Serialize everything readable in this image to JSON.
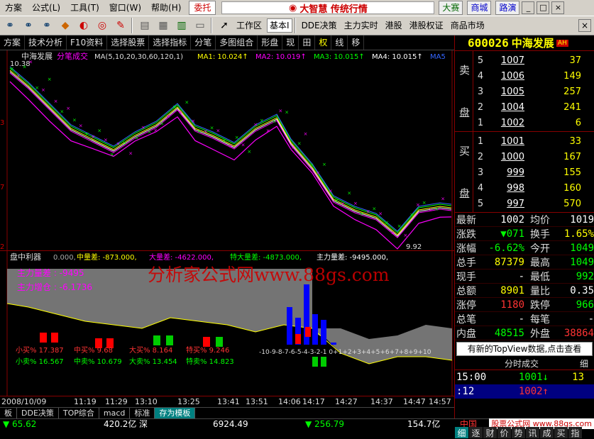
{
  "menu": {
    "items": [
      "方案",
      "公式(L)",
      "工具(T)",
      "窗口(W)",
      "帮助(H)"
    ],
    "trust": "委托",
    "brand": "大智慧 传统行情",
    "right_buttons": [
      "大赛",
      "商城",
      "路演"
    ],
    "win_controls": [
      "_",
      "□",
      "×"
    ]
  },
  "toolbar": {
    "workspace": "工作区",
    "workspace_select": "基本Ⅰ",
    "links": [
      "DDE决策",
      "主力实时",
      "港股",
      "港股权证",
      "商品市场"
    ],
    "icons": [
      "binoculars-icon",
      "binoculars-icon",
      "diamond-icon",
      "chart-icon",
      "target-icon",
      "pen-icon",
      "grid-icon",
      "books-icon",
      "pointer-icon"
    ]
  },
  "stockbar": {
    "items": [
      "方案",
      "技术分析",
      "F10资料",
      "选择股票",
      "选择指标",
      "分笔",
      "多图组合",
      "形盘",
      "现",
      "田",
      "权",
      "线",
      "移"
    ]
  },
  "chart": {
    "title_name": "中海发展",
    "title_mode": "分笔成交",
    "ma_params": "MA(5,10,20,30,60,120,1)",
    "ma_values": [
      {
        "label": "MA1: 10.024↑",
        "color": "#ffff00"
      },
      {
        "label": "MA2: 10.019↑",
        "color": "#ff00ff"
      },
      {
        "label": "MA3: 10.015↑",
        "color": "#00ff00"
      },
      {
        "label": "MA4: 10.015↑",
        "color": "#ffffff"
      },
      {
        "label": "MA5",
        "color": "#3366ff"
      }
    ],
    "high_label": "10.38",
    "low_label": "9.92",
    "y_ticks": [
      "3",
      "7",
      "2"
    ]
  },
  "indicator": {
    "name": "盘中利器",
    "values": [
      {
        "label": "0.000,",
        "color": "#aaaaaa"
      },
      {
        "label": "中量差: -873.000,",
        "color": "#ffff00"
      },
      {
        "label": "大量差: -4622.000,",
        "color": "#ff00ff"
      },
      {
        "label": "特大量差: -4873.000,",
        "color": "#00ff00"
      },
      {
        "label": "主力量差: -9495.000,",
        "color": "#ffffff"
      }
    ],
    "line2": "主力量差 :  -9495",
    "line3": "主力增仓 :  -6.1736",
    "buy_sell": [
      {
        "buy": "小买% 17.387",
        "sell": "小卖% 16.567"
      },
      {
        "buy": "中买% 9.68",
        "sell": "中卖% 10.679"
      },
      {
        "buy": "大买% 8.164",
        "sell": "大卖% 13.454"
      },
      {
        "buy": "特买% 9.246",
        "sell": "特卖% 14.823"
      }
    ],
    "scale_label": "-10-9-8-7-6-5-4-3-2-1    0+1+2+3+4+5+6+7+8+9+10"
  },
  "watermark": "分析家公式网www.88gs.com",
  "time_axis": [
    "2008/10/09",
    "11:19",
    "11:29",
    "13:10",
    "13:25",
    "13:41",
    "13:51",
    "14:06",
    "14:17",
    "14:27",
    "14:37",
    "14:47",
    "14:57"
  ],
  "bottom_tabs": [
    "板",
    "DDE决策",
    "TOP综合",
    "macd",
    "标准",
    "存为模板"
  ],
  "status": {
    "v1": "▼ 65.62",
    "v2": "420.2亿",
    "v3": "深",
    "v4": "6924.49",
    "v5": "▼ 256.79",
    "v6": "154.7亿",
    "v7": "中国",
    "site": "股票公式网 www.88gs.com"
  },
  "quote": {
    "code": "600026",
    "name": "中海发展",
    "badge": "AH",
    "sell_side": "卖盘",
    "buy_side": "买盘",
    "asks": [
      {
        "lvl": "5",
        "price": "1007",
        "vol": "37"
      },
      {
        "lvl": "4",
        "price": "1006",
        "vol": "149"
      },
      {
        "lvl": "3",
        "price": "1005",
        "vol": "257"
      },
      {
        "lvl": "2",
        "price": "1004",
        "vol": "241"
      },
      {
        "lvl": "1",
        "price": "1002",
        "vol": "6"
      }
    ],
    "bids": [
      {
        "lvl": "1",
        "price": "1001",
        "vol": "33"
      },
      {
        "lvl": "2",
        "price": "1000",
        "vol": "167"
      },
      {
        "lvl": "3",
        "price": "999",
        "vol": "155"
      },
      {
        "lvl": "4",
        "price": "998",
        "vol": "160"
      },
      {
        "lvl": "5",
        "price": "997",
        "vol": "570"
      }
    ],
    "stats": [
      {
        "l1": "最新",
        "v1": "1002",
        "c1": "w",
        "l2": "均价",
        "v2": "1019",
        "c2": "w"
      },
      {
        "l1": "涨跌",
        "v1": "▼071",
        "c1": "g",
        "l2": "换手",
        "v2": "1.65%",
        "c2": "y"
      },
      {
        "l1": "涨幅",
        "v1": "-6.62%",
        "c1": "g",
        "l2": "今开",
        "v2": "1049",
        "c2": "g"
      },
      {
        "l1": "总手",
        "v1": "87379",
        "c1": "y",
        "l2": "最高",
        "v2": "1049",
        "c2": "g"
      },
      {
        "l1": "现手",
        "v1": "-",
        "c1": "w",
        "l2": "最低",
        "v2": "992",
        "c2": "g"
      },
      {
        "l1": "总额",
        "v1": "8901",
        "c1": "y",
        "l2": "量比",
        "v2": "0.35",
        "c2": "w"
      },
      {
        "l1": "涨停",
        "v1": "1180",
        "c1": "r",
        "l2": "跌停",
        "v2": "966",
        "c2": "g"
      },
      {
        "l1": "总笔",
        "v1": "-",
        "c1": "w",
        "l2": "每笔",
        "v2": "-",
        "c2": "w"
      },
      {
        "l1": "内盘",
        "v1": "48515",
        "c1": "g",
        "l2": "外盘",
        "v2": "38864",
        "c2": "r"
      }
    ],
    "topview": "有新的TopView数据,点击查看",
    "ts_title": "分时成交",
    "ts_detail": "细",
    "ticks": [
      {
        "time": "15:00",
        "price": "1001↓",
        "pcolor": "g",
        "vol": "13"
      },
      {
        "time": ":12",
        "price": "1002↑",
        "pcolor": "r",
        "vol": ""
      }
    ],
    "tabs": [
      "细",
      "逐",
      "财",
      "价",
      "势",
      "讯",
      "成",
      "买",
      "指"
    ]
  },
  "colors": {
    "up": "#ff3333",
    "down": "#00ff00",
    "accent": "#ffff00"
  }
}
